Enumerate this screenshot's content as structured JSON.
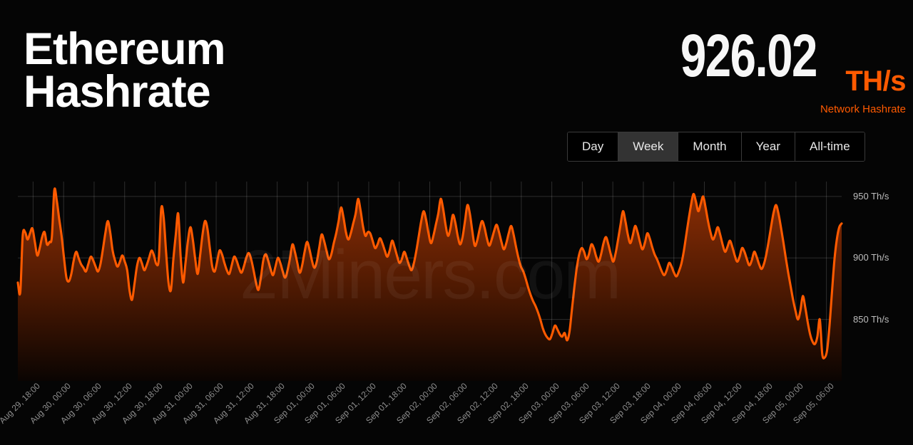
{
  "header": {
    "title": "Ethereum\nHashrate",
    "value": "926.02",
    "unit": "TH/s",
    "unit_sub": "Network Hashrate",
    "accent_color": "#ff5a00",
    "value_color": "#f7f7f7"
  },
  "range_tabs": {
    "items": [
      {
        "label": "Day",
        "active": false
      },
      {
        "label": "Week",
        "active": true
      },
      {
        "label": "Month",
        "active": false
      },
      {
        "label": "Year",
        "active": false
      },
      {
        "label": "All-time",
        "active": false
      }
    ]
  },
  "watermark": "2Miners.com",
  "chart_data": {
    "type": "area",
    "title": "Ethereum Hashrate",
    "xlabel": "",
    "ylabel": "Th/s",
    "unit": "Th/s",
    "ylim": [
      800,
      965
    ],
    "yticks": [
      850,
      900,
      950
    ],
    "ytick_labels": [
      "850 Th/s",
      "900 Th/s",
      "950 Th/s"
    ],
    "grid": true,
    "legend": "none",
    "line_color": "#ff5a00",
    "fill_top_color": "#8c2e05",
    "fill_bottom_color": "#0a0402",
    "x_tick_labels": [
      "Aug 29, 18:00",
      "Aug 30, 00:00",
      "Aug 30, 06:00",
      "Aug 30, 12:00",
      "Aug 30, 18:00",
      "Aug 31, 00:00",
      "Aug 31, 06:00",
      "Aug 31, 12:00",
      "Aug 31, 18:00",
      "Sep 01, 00:00",
      "Sep 01, 06:00",
      "Sep 01, 12:00",
      "Sep 01, 18:00",
      "Sep 02, 00:00",
      "Sep 02, 06:00",
      "Sep 02, 12:00",
      "Sep 02, 18:00",
      "Sep 03, 00:00",
      "Sep 03, 06:00",
      "Sep 03, 12:00",
      "Sep 03, 18:00",
      "Sep 04, 00:00",
      "Sep 04, 06:00",
      "Sep 04, 12:00",
      "Sep 04, 18:00",
      "Sep 05, 00:00",
      "Sep 05, 06:00"
    ],
    "x_start": "Aug 29, 15:00",
    "x_end": "Sep 05, 09:00",
    "series": [
      {
        "name": "Network Hashrate",
        "values": [
          880,
          872,
          918,
          921,
          915,
          920,
          924,
          913,
          902,
          908,
          917,
          921,
          911,
          913,
          917,
          955,
          947,
          932,
          918,
          900,
          884,
          881,
          887,
          898,
          905,
          900,
          895,
          892,
          889,
          895,
          901,
          898,
          893,
          889,
          895,
          907,
          920,
          930,
          921,
          906,
          898,
          893,
          897,
          902,
          897,
          890,
          873,
          866,
          879,
          893,
          900,
          896,
          890,
          894,
          900,
          906,
          902,
          895,
          899,
          940,
          933,
          905,
          880,
          874,
          899,
          919,
          936,
          901,
          880,
          896,
          914,
          925,
          915,
          899,
          887,
          902,
          919,
          930,
          924,
          908,
          893,
          889,
          897,
          906,
          903,
          896,
          890,
          887,
          894,
          901,
          898,
          892,
          888,
          893,
          900,
          904,
          899,
          890,
          880,
          874,
          884,
          898,
          903,
          898,
          891,
          886,
          893,
          900,
          896,
          889,
          884,
          890,
          900,
          911,
          905,
          896,
          888,
          894,
          905,
          913,
          907,
          898,
          892,
          897,
          908,
          919,
          914,
          906,
          899,
          903,
          912,
          920,
          930,
          941,
          933,
          921,
          915,
          920,
          928,
          936,
          948,
          939,
          926,
          918,
          921,
          920,
          914,
          908,
          911,
          916,
          912,
          906,
          901,
          906,
          914,
          909,
          902,
          896,
          899,
          905,
          900,
          894,
          890,
          896,
          906,
          918,
          930,
          938,
          931,
          920,
          912,
          918,
          927,
          936,
          948,
          940,
          927,
          918,
          924,
          935,
          929,
          918,
          911,
          917,
          930,
          943,
          936,
          922,
          910,
          914,
          923,
          930,
          925,
          916,
          910,
          915,
          922,
          927,
          921,
          913,
          907,
          912,
          920,
          926,
          919,
          909,
          900,
          893,
          889,
          883,
          876,
          870,
          865,
          861,
          856,
          850,
          843,
          838,
          835,
          834,
          839,
          845,
          842,
          838,
          836,
          839,
          833,
          840,
          858,
          876,
          892,
          903,
          908,
          905,
          899,
          903,
          911,
          908,
          901,
          897,
          903,
          912,
          917,
          911,
          903,
          897,
          904,
          915,
          927,
          938,
          930,
          919,
          912,
          918,
          926,
          921,
          913,
          907,
          912,
          920,
          916,
          909,
          903,
          899,
          894,
          889,
          886,
          890,
          896,
          893,
          888,
          885,
          889,
          895,
          905,
          918,
          931,
          943,
          952,
          946,
          938,
          944,
          950,
          941,
          930,
          921,
          915,
          919,
          925,
          919,
          911,
          905,
          909,
          914,
          909,
          902,
          897,
          901,
          908,
          905,
          899,
          894,
          898,
          905,
          901,
          895,
          891,
          895,
          903,
          914,
          926,
          937,
          943,
          936,
          925,
          913,
          900,
          888,
          877,
          866,
          857,
          850,
          857,
          869,
          860,
          848,
          838,
          832,
          830,
          836,
          850,
          822,
          819,
          825,
          845,
          872,
          898,
          915,
          925,
          928
        ]
      }
    ]
  }
}
